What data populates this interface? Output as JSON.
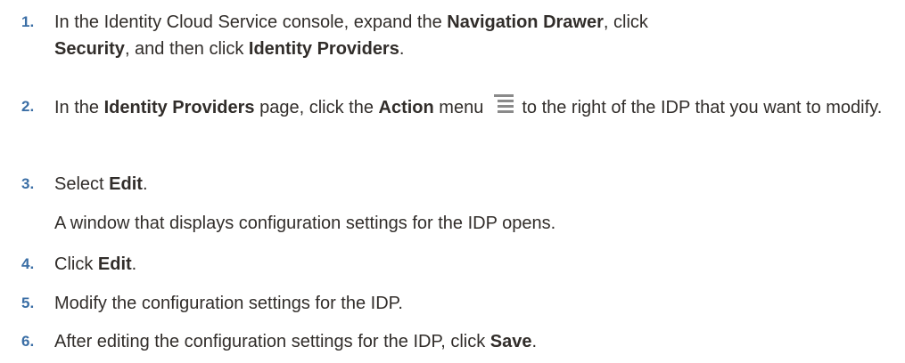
{
  "steps": [
    {
      "number": "1.",
      "t1": "In the Identity Cloud Service console, expand the ",
      "b1": "Navigation Drawer",
      "t2": ", click ",
      "b2": "Security",
      "t3": ", and then click ",
      "b3": "Identity Providers",
      "t4": "."
    },
    {
      "number": "2.",
      "t1": "In the ",
      "b1": "Identity Providers",
      "t2": " page, click the ",
      "b2": "Action",
      "t3": " menu",
      "icon": "action-menu-icon",
      "t4": "to the right of the IDP that you want to modify."
    },
    {
      "number": "3.",
      "t1": "Select ",
      "b1": "Edit",
      "t2": ".",
      "note": "A window that displays configuration settings for the IDP opens."
    },
    {
      "number": "4.",
      "t1": "Click ",
      "b1": "Edit",
      "t2": "."
    },
    {
      "number": "5.",
      "t1": "Modify the configuration settings for the IDP."
    },
    {
      "number": "6.",
      "t1": "After editing the configuration settings for the IDP, click ",
      "b1": "Save",
      "t2": "."
    }
  ]
}
